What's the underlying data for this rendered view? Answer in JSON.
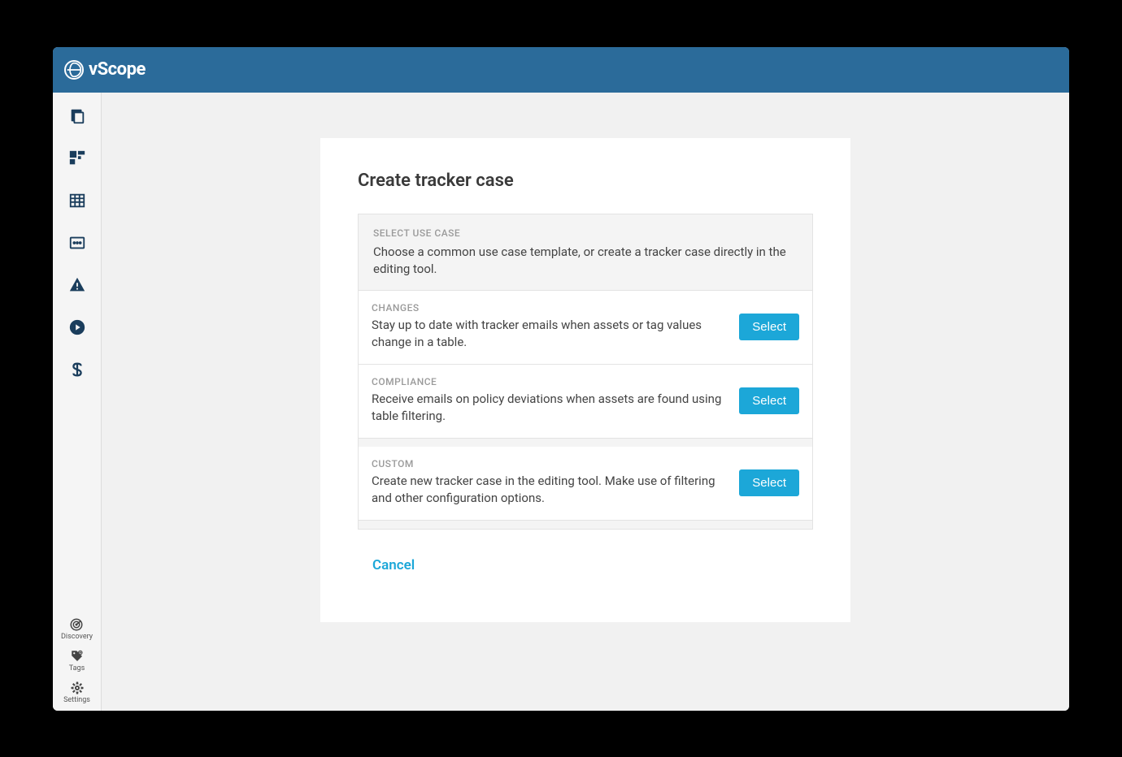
{
  "header": {
    "app_name": "vScope"
  },
  "sidebar": {
    "top_items": [
      {
        "name": "documents-icon"
      },
      {
        "name": "dashboard-icon"
      },
      {
        "name": "table-icon"
      },
      {
        "name": "terminal-icon"
      },
      {
        "name": "alert-icon"
      },
      {
        "name": "play-icon"
      },
      {
        "name": "dollar-icon"
      }
    ],
    "bottom_items": [
      {
        "name": "discovery",
        "label": "Discovery"
      },
      {
        "name": "tags",
        "label": "Tags"
      },
      {
        "name": "settings",
        "label": "Settings"
      }
    ]
  },
  "panel": {
    "title": "Create tracker case",
    "section_label": "SELECT USE CASE",
    "section_desc": "Choose a common use case template, or create a tracker case directly in the editing tool.",
    "cases": [
      {
        "label": "CHANGES",
        "desc": "Stay up to date with tracker emails when assets or tag values change in a table.",
        "button": "Select"
      },
      {
        "label": "COMPLIANCE",
        "desc": "Receive emails on policy deviations when assets are found using table filtering.",
        "button": "Select"
      },
      {
        "label": "CUSTOM",
        "desc": "Create new tracker case in the editing tool. Make use of filtering and other configuration options.",
        "button": "Select"
      }
    ],
    "cancel": "Cancel"
  }
}
